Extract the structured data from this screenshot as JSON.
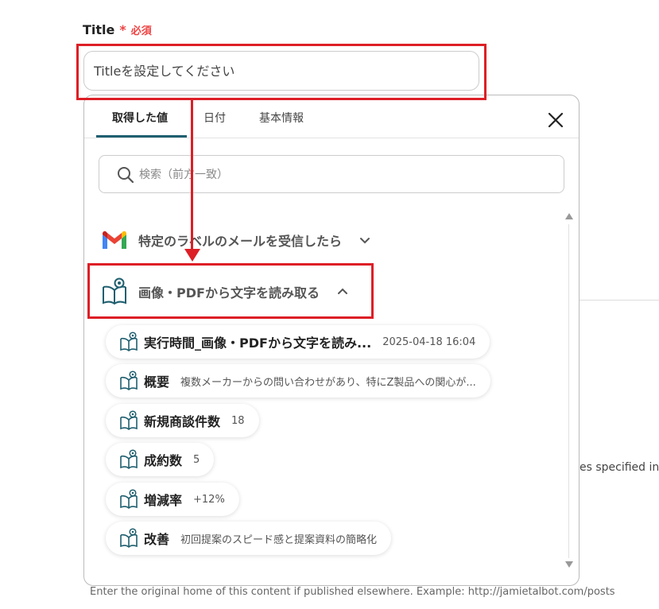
{
  "field": {
    "label": "Title",
    "required_mark": "*",
    "required_text": "必須",
    "placeholder": "Titleを設定してください"
  },
  "panel": {
    "tabs": [
      {
        "label": "取得した値",
        "active": true
      },
      {
        "label": "日付",
        "active": false
      },
      {
        "label": "基本情報",
        "active": false
      }
    ],
    "search_placeholder": "検索（前方一致）",
    "sections": [
      {
        "title": "特定のラベルのメールを受信したら",
        "icon": "gmail-icon",
        "expanded": false
      },
      {
        "title": "画像・PDFから文字を読み取る",
        "icon": "ocr-book-icon",
        "expanded": true
      }
    ],
    "items": [
      {
        "name": "実行時間_画像・PDFから文字を読み...",
        "value": "2025-04-18 16:04"
      },
      {
        "name": "概要",
        "value": "複数メーカーからの問い合わせがあり、特にZ製品への関心が..."
      },
      {
        "name": "新規商談件数",
        "value": "18"
      },
      {
        "name": "成約数",
        "value": "5"
      },
      {
        "name": "増減率",
        "value": "+12%"
      },
      {
        "name": "改善",
        "value": "初回提案のスピード感と提案資料の簡略化"
      }
    ]
  },
  "background": {
    "right_text": "es specified in",
    "bottom_text": "Enter the original home of this content if published elsewhere. Example: http://jamietalbot.com/posts"
  },
  "colors": {
    "accent": "#1f5f6f",
    "annotation_red": "#dd1f26",
    "required_red": "#e44444"
  }
}
